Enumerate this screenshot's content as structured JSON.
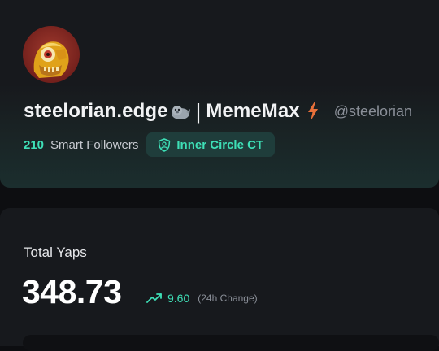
{
  "profile": {
    "display_name": "steelorian.edge",
    "separator": "|",
    "project_name": "MemeMax",
    "handle": "@steelorian",
    "name_emoji_icon": "seal-icon",
    "project_emoji_icon": "lightning-bolt-icon",
    "smart_followers": {
      "count": "210",
      "label": "Smart Followers"
    },
    "badge": {
      "icon": "shield-user-icon",
      "label": "Inner Circle CT"
    }
  },
  "yaps": {
    "title": "Total Yaps",
    "value": "348.73",
    "change": {
      "icon": "trending-up-icon",
      "value": "9.60",
      "label": "(24h Change)"
    }
  },
  "colors": {
    "accent": "#3ee0b7",
    "background": "#0d0e11",
    "card": "#17191d",
    "badge_bg": "#1f3d3b",
    "muted_text": "#8a8f98"
  }
}
